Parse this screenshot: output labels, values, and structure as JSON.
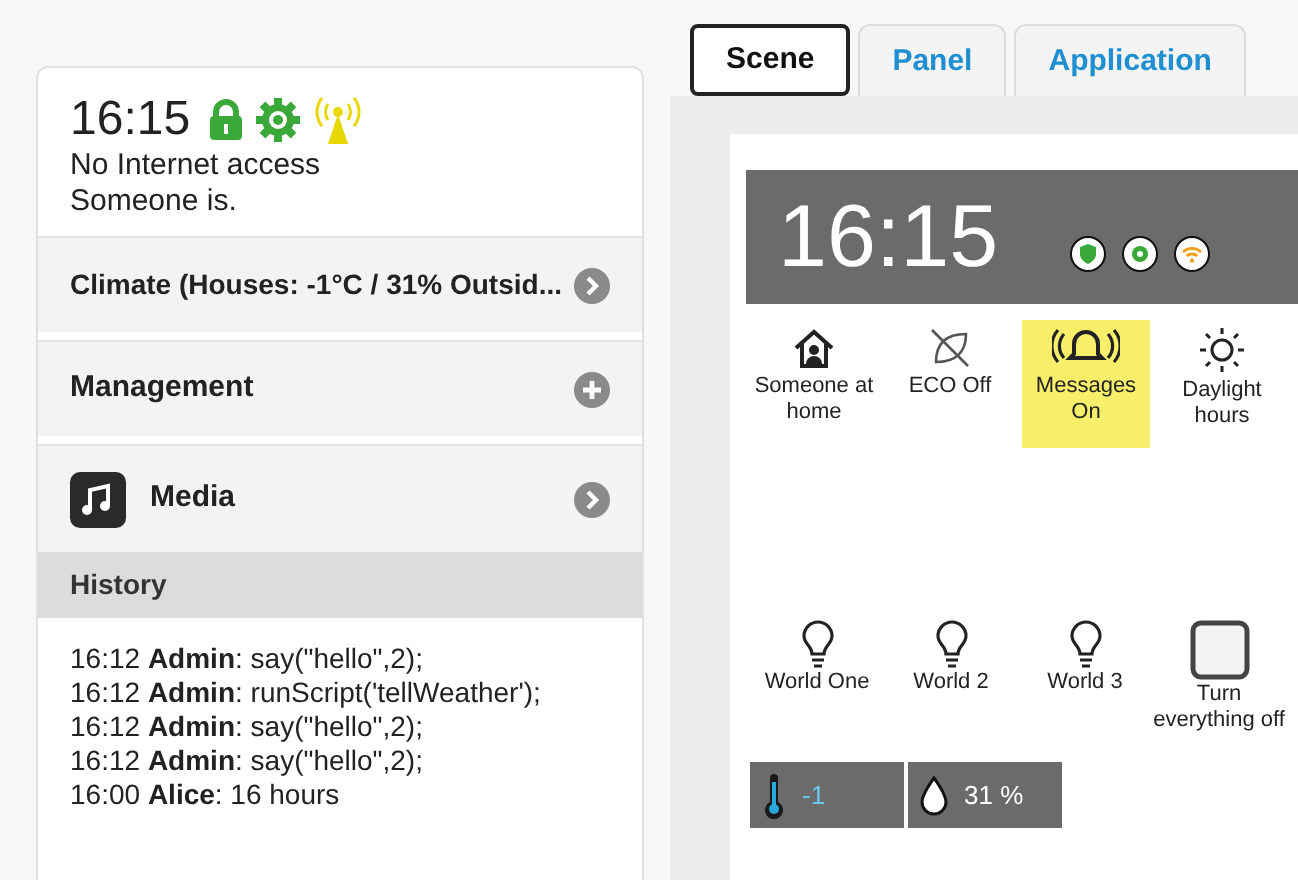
{
  "status_card": {
    "time": "16:15",
    "status_text": "No Internet access",
    "presence": "Someone is."
  },
  "menu": [
    {
      "kind": "arrow",
      "label": "Climate (Houses: -1°C / 31% Outsid..."
    },
    {
      "kind": "plus",
      "label": "Management"
    },
    {
      "kind": "media",
      "label": "Media"
    }
  ],
  "history": {
    "title": "History",
    "entries": [
      "16:12 **Admin**: say(\"hello\",2);",
      "16:12 **Admin**: runScript('tellWeather');",
      "16:12 **Admin**: say(\"hello\",2);",
      "16:12 **Admin**: say(\"hello\",2);",
      "16:00 **Alice**: 16 hours"
    ]
  },
  "tabs": [
    {
      "label": "Scene",
      "selected": true
    },
    {
      "label": "Panel",
      "selected": false
    },
    {
      "label": "Application",
      "selected": false
    }
  ],
  "panel": {
    "time": "16:15",
    "scenes": [
      {
        "kind": "home",
        "label": "Someone at home",
        "on": false
      },
      {
        "kind": "eco",
        "label": "ECO Off",
        "on": false
      },
      {
        "kind": "bell",
        "label": "Messages On",
        "on": true
      },
      {
        "kind": "sun",
        "label": "Daylight hours",
        "on": false
      }
    ],
    "lights": [
      {
        "kind": "bulb",
        "label": "World One"
      },
      {
        "kind": "bulb",
        "label": "World 2"
      },
      {
        "kind": "bulb",
        "label": "World 3"
      },
      {
        "kind": "square",
        "label": "Turn everything off"
      }
    ],
    "sensors": [
      {
        "kind": "temperature",
        "value": "-1"
      },
      {
        "kind": "humidity",
        "value": "31 %"
      }
    ]
  }
}
